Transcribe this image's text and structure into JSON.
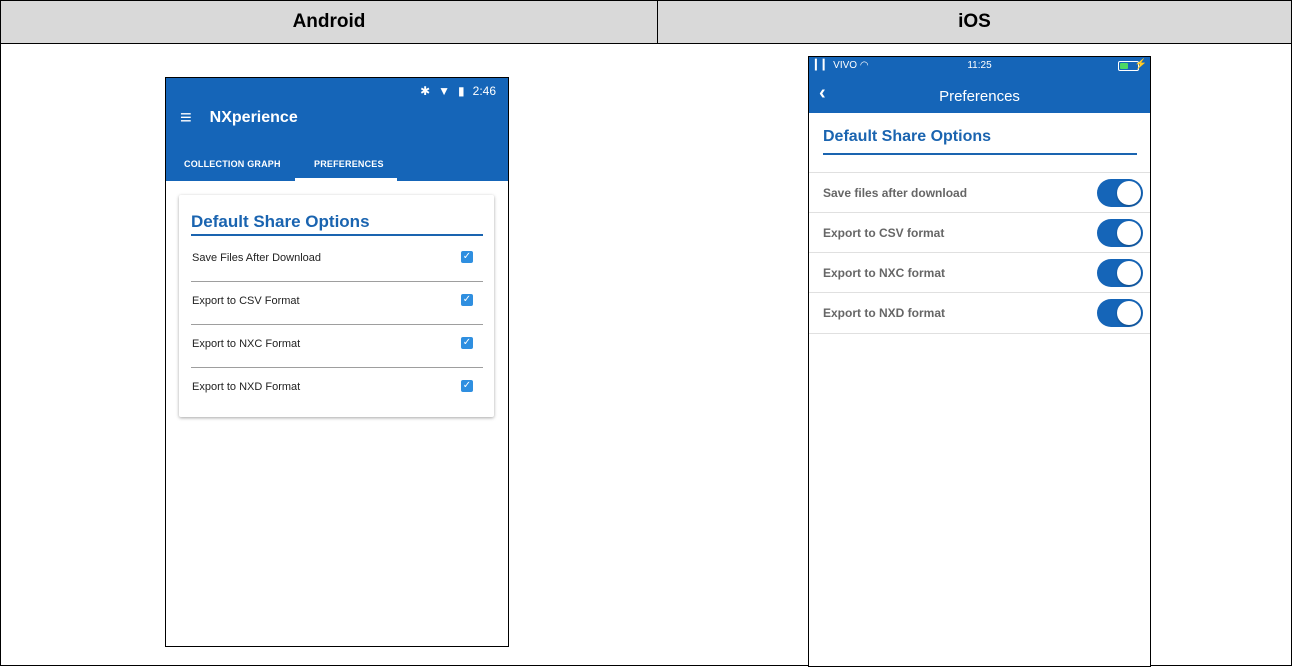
{
  "table": {
    "android_header": "Android",
    "ios_header": "iOS"
  },
  "android": {
    "status": {
      "time": "2:46"
    },
    "app_title": "NXperience",
    "tabs": [
      {
        "label": "COLLECTION GRAPH",
        "selected": false
      },
      {
        "label": "PREFERENCES",
        "selected": true
      }
    ],
    "card": {
      "title": "Default Share Options",
      "options": [
        {
          "label": "Save Files After Download",
          "checked": true
        },
        {
          "label": "Export to CSV Format",
          "checked": true
        },
        {
          "label": "Export to NXC Format",
          "checked": true
        },
        {
          "label": "Export to NXD Format",
          "checked": true
        }
      ]
    }
  },
  "ios": {
    "status": {
      "carrier": "VIVO",
      "time": "11:25"
    },
    "nav_title": "Preferences",
    "section_title": "Default Share Options",
    "options": [
      {
        "label": "Save files after download",
        "on": true
      },
      {
        "label": "Export to CSV format",
        "on": true
      },
      {
        "label": "Export to NXC format",
        "on": true
      },
      {
        "label": "Export to NXD format",
        "on": true
      }
    ]
  },
  "colors": {
    "primary_blue": "#1565b8",
    "title_blue": "#1a64b0",
    "checkbox_blue": "#2f8fe0",
    "header_gray": "#d9d9d9"
  }
}
